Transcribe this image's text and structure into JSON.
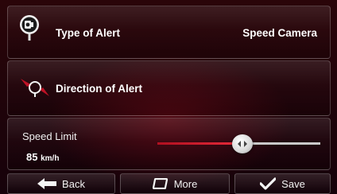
{
  "alert_type": {
    "title": "Type of Alert",
    "value": "Speed Camera",
    "icon": "speed-camera-icon"
  },
  "direction": {
    "title": "Direction of Alert",
    "icon": "direction-icon"
  },
  "speed_limit": {
    "label": "Speed Limit",
    "value": "85",
    "unit": "km/h",
    "slider_fraction": 0.52
  },
  "buttons": {
    "back": "Back",
    "more": "More",
    "save": "Save"
  },
  "colors": {
    "accent": "#e82b3a",
    "background": "#1a0306"
  }
}
